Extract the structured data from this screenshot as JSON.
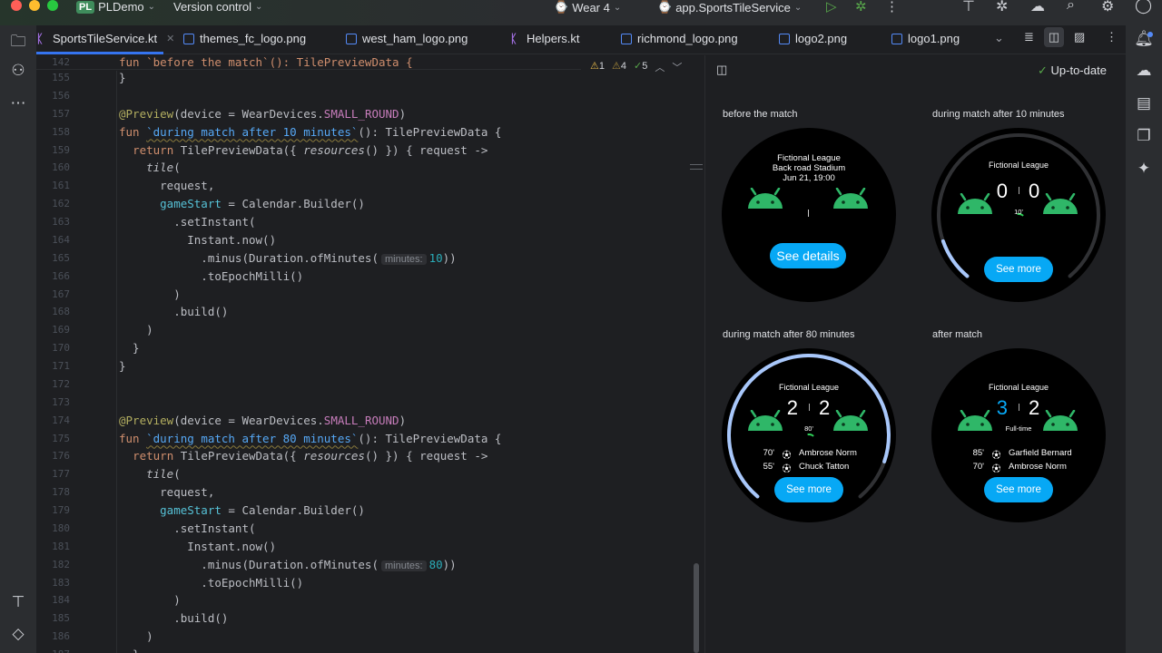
{
  "titlebar": {
    "project_badge": "PL",
    "project": "PLDemo",
    "vcs": "Version control",
    "device": "Wear 4",
    "run_config": "app.SportsTileService"
  },
  "tabs": [
    {
      "label": "SportsTileService.kt",
      "type": "kotlin",
      "active": true
    },
    {
      "label": "themes_fc_logo.png",
      "type": "image"
    },
    {
      "label": "west_ham_logo.png",
      "type": "image"
    },
    {
      "label": "Helpers.kt",
      "type": "kotlin"
    },
    {
      "label": "richmond_logo.png",
      "type": "image"
    },
    {
      "label": "logo2.png",
      "type": "image"
    },
    {
      "label": "logo1.png",
      "type": "image"
    }
  ],
  "inspections": {
    "errors": "1",
    "warnings": "4",
    "ok": "5"
  },
  "sticky": {
    "n": "142",
    "text": "fun `before the match`(): TilePreviewData {"
  },
  "code": [
    {
      "n": "155",
      "t": [
        [
          "}",
          ""
        ]
      ]
    },
    {
      "n": "156",
      "t": []
    },
    {
      "n": "157",
      "t": [
        [
          "@Preview",
          "ann"
        ],
        [
          "(device = WearDevices.",
          ""
        ],
        [
          "SMALL_ROUND",
          "const"
        ],
        [
          ")",
          ""
        ]
      ]
    },
    {
      "n": "158",
      "t": [
        [
          "fun ",
          "kw"
        ],
        [
          "`during match after 10 minutes`",
          "fnn"
        ],
        [
          "(): TilePreviewData {",
          ""
        ]
      ]
    },
    {
      "n": "159",
      "t": [
        [
          "  ",
          ""
        ],
        [
          "return ",
          "kw"
        ],
        [
          "TilePreviewData({ ",
          ""
        ],
        [
          "resources",
          "it"
        ],
        [
          "() }) { request ->",
          ""
        ]
      ]
    },
    {
      "n": "160",
      "t": [
        [
          "    ",
          ""
        ],
        [
          "tile",
          "it"
        ],
        [
          "(",
          ""
        ]
      ]
    },
    {
      "n": "161",
      "t": [
        [
          "      request,",
          ""
        ]
      ]
    },
    {
      "n": "162",
      "t": [
        [
          "      ",
          ""
        ],
        [
          "gameStart",
          "param"
        ],
        [
          " = Calendar.Builder()",
          ""
        ]
      ]
    },
    {
      "n": "163",
      "t": [
        [
          "        .setInstant(",
          ""
        ]
      ]
    },
    {
      "n": "164",
      "t": [
        [
          "          Instant.now()",
          ""
        ]
      ]
    },
    {
      "n": "165",
      "t": [
        [
          "            .minus(Duration.ofMinutes(",
          ""
        ],
        [
          "minutes:",
          "hint"
        ],
        [
          "10",
          "num"
        ],
        [
          "))",
          ""
        ]
      ]
    },
    {
      "n": "166",
      "t": [
        [
          "            .toEpochMilli()",
          ""
        ]
      ]
    },
    {
      "n": "167",
      "t": [
        [
          "        )",
          ""
        ]
      ]
    },
    {
      "n": "168",
      "t": [
        [
          "        .build()",
          ""
        ]
      ]
    },
    {
      "n": "169",
      "t": [
        [
          "    )",
          ""
        ]
      ]
    },
    {
      "n": "170",
      "t": [
        [
          "  }",
          ""
        ]
      ]
    },
    {
      "n": "171",
      "t": [
        [
          "}",
          ""
        ]
      ]
    },
    {
      "n": "172",
      "t": []
    },
    {
      "n": "173",
      "t": []
    },
    {
      "n": "174",
      "t": [
        [
          "@Preview",
          "ann"
        ],
        [
          "(device = WearDevices.",
          ""
        ],
        [
          "SMALL_ROUND",
          "const"
        ],
        [
          ")",
          ""
        ]
      ]
    },
    {
      "n": "175",
      "t": [
        [
          "fun ",
          "kw"
        ],
        [
          "`during match after 80 minutes`",
          "fnn"
        ],
        [
          "(): TilePreviewData {",
          ""
        ]
      ]
    },
    {
      "n": "176",
      "t": [
        [
          "  ",
          ""
        ],
        [
          "return ",
          "kw"
        ],
        [
          "TilePreviewData({ ",
          ""
        ],
        [
          "resources",
          "it"
        ],
        [
          "() }) { request ->",
          ""
        ]
      ]
    },
    {
      "n": "177",
      "t": [
        [
          "    ",
          ""
        ],
        [
          "tile",
          "it"
        ],
        [
          "(",
          ""
        ]
      ]
    },
    {
      "n": "178",
      "t": [
        [
          "      request,",
          ""
        ]
      ]
    },
    {
      "n": "179",
      "t": [
        [
          "      ",
          ""
        ],
        [
          "gameStart",
          "param"
        ],
        [
          " = Calendar.Builder()",
          ""
        ]
      ]
    },
    {
      "n": "180",
      "t": [
        [
          "        .setInstant(",
          ""
        ]
      ]
    },
    {
      "n": "181",
      "t": [
        [
          "          Instant.now()",
          ""
        ]
      ]
    },
    {
      "n": "182",
      "t": [
        [
          "            .minus(Duration.ofMinutes(",
          ""
        ],
        [
          "minutes:",
          "hint"
        ],
        [
          "80",
          "num"
        ],
        [
          "))",
          ""
        ]
      ]
    },
    {
      "n": "183",
      "t": [
        [
          "            .toEpochMilli()",
          ""
        ]
      ]
    },
    {
      "n": "184",
      "t": [
        [
          "        )",
          ""
        ]
      ]
    },
    {
      "n": "185",
      "t": [
        [
          "        .build()",
          ""
        ]
      ]
    },
    {
      "n": "186",
      "t": [
        [
          "    )",
          ""
        ]
      ]
    },
    {
      "n": "187",
      "t": [
        [
          "  }",
          ""
        ]
      ]
    }
  ],
  "preview": {
    "status": "Up-to-date",
    "watches": [
      {
        "label": "before the match",
        "league": "Fictional League",
        "venue": "Back road Stadium",
        "date": "Jun 21, 19:00",
        "button": "See details"
      },
      {
        "label": "during match after 10 minutes",
        "league": "Fictional League",
        "home": "0",
        "away": "0",
        "minute": "10'",
        "progress": 0.11,
        "button": "See more"
      },
      {
        "label": "during match after 80 minutes",
        "league": "Fictional League",
        "home": "2",
        "away": "2",
        "minute": "80'",
        "progress": 0.89,
        "button": "See more",
        "events": [
          {
            "min": "70'",
            "name": "Ambrose Norm"
          },
          {
            "min": "55'",
            "name": "Chuck Tatton"
          }
        ]
      },
      {
        "label": "after match",
        "league": "Fictional League",
        "home": "3",
        "away": "2",
        "status": "Full-time",
        "button": "See more",
        "events": [
          {
            "min": "85'",
            "name": "Garfield Bernard"
          },
          {
            "min": "70'",
            "name": "Ambrose Norm"
          }
        ]
      }
    ]
  },
  "colors": {
    "accent": "#548af7",
    "button": "#07a8f5",
    "android": "#2fb768",
    "progress": "#a8c7fa",
    "winner": "#07a8f5"
  }
}
